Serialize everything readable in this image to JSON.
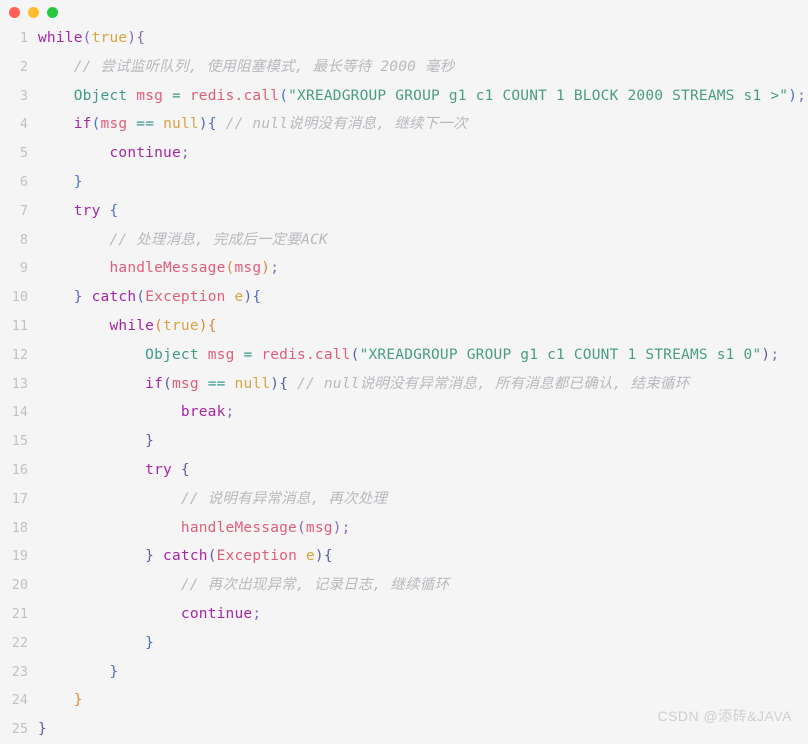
{
  "window": {
    "title_bar": {
      "close_label": "close",
      "minimize_label": "minimize",
      "maximize_label": "maximize"
    }
  },
  "watermark": "CSDN @添砖&JAVA",
  "editor": {
    "language": "java",
    "first_line_number": 1,
    "last_line_number": 25,
    "line_numbers": [
      "1",
      "2",
      "3",
      "4",
      "5",
      "6",
      "7",
      "8",
      "9",
      "10",
      "11",
      "12",
      "13",
      "14",
      "15",
      "16",
      "17",
      "18",
      "19",
      "20",
      "21",
      "22",
      "23",
      "24",
      "25"
    ],
    "lines": [
      {
        "n": "1",
        "text": "while(true){"
      },
      {
        "n": "2",
        "text": "    // 尝试监听队列, 使用阻塞模式, 最长等待 2000 毫秒"
      },
      {
        "n": "3",
        "text": "    Object msg = redis.call(\"XREADGROUP GROUP g1 c1 COUNT 1 BLOCK 2000 STREAMS s1 >\");"
      },
      {
        "n": "4",
        "text": "    if(msg == null){ // null说明没有消息, 继续下一次"
      },
      {
        "n": "5",
        "text": "        continue;"
      },
      {
        "n": "6",
        "text": "    }"
      },
      {
        "n": "7",
        "text": "    try {"
      },
      {
        "n": "8",
        "text": "        // 处理消息, 完成后一定要ACK"
      },
      {
        "n": "9",
        "text": "        handleMessage(msg);"
      },
      {
        "n": "10",
        "text": "    } catch(Exception e){"
      },
      {
        "n": "11",
        "text": "        while(true){"
      },
      {
        "n": "12",
        "text": "            Object msg = redis.call(\"XREADGROUP GROUP g1 c1 COUNT 1 STREAMS s1 0\");"
      },
      {
        "n": "13",
        "text": "            if(msg == null){ // null说明没有异常消息, 所有消息都已确认, 结束循环"
      },
      {
        "n": "14",
        "text": "                break;"
      },
      {
        "n": "15",
        "text": "            }"
      },
      {
        "n": "16",
        "text": "            try {"
      },
      {
        "n": "17",
        "text": "                // 说明有异常消息, 再次处理"
      },
      {
        "n": "18",
        "text": "                handleMessage(msg);"
      },
      {
        "n": "19",
        "text": "            } catch(Exception e){"
      },
      {
        "n": "20",
        "text": "                // 再次出现异常, 记录日志, 继续循环"
      },
      {
        "n": "21",
        "text": "                continue;"
      },
      {
        "n": "22",
        "text": "            }"
      },
      {
        "n": "23",
        "text": "        }"
      },
      {
        "n": "24",
        "text": "    }"
      },
      {
        "n": "25",
        "text": "}"
      }
    ],
    "tokens": [
      [
        {
          "t": "while",
          "c": "t-kw"
        },
        {
          "t": "(",
          "c": "t-p1"
        },
        {
          "t": "true",
          "c": "t-bool"
        },
        {
          "t": ")",
          "c": "t-p1"
        },
        {
          "t": "{",
          "c": "t-p1"
        }
      ],
      [
        {
          "t": "    // 尝试监听队列, 使用阻塞模式, 最长等待 2000 毫秒",
          "c": "t-com"
        }
      ],
      [
        {
          "t": "    ",
          "c": "t-plain"
        },
        {
          "t": "Object",
          "c": "t-type"
        },
        {
          "t": " ",
          "c": "t-plain"
        },
        {
          "t": "msg",
          "c": "t-var"
        },
        {
          "t": " ",
          "c": "t-plain"
        },
        {
          "t": "=",
          "c": "t-op"
        },
        {
          "t": " ",
          "c": "t-plain"
        },
        {
          "t": "redis.call",
          "c": "t-var"
        },
        {
          "t": "(",
          "c": "t-p2"
        },
        {
          "t": "\"XREADGROUP GROUP g1 c1 COUNT 1 BLOCK 2000 STREAMS s1 >\"",
          "c": "t-str"
        },
        {
          "t": ")",
          "c": "t-p2"
        },
        {
          "t": ";",
          "c": "t-p1"
        }
      ],
      [
        {
          "t": "    ",
          "c": "t-plain"
        },
        {
          "t": "if",
          "c": "t-kw"
        },
        {
          "t": "(",
          "c": "t-p2"
        },
        {
          "t": "msg",
          "c": "t-var"
        },
        {
          "t": " ",
          "c": "t-plain"
        },
        {
          "t": "==",
          "c": "t-op"
        },
        {
          "t": " ",
          "c": "t-plain"
        },
        {
          "t": "null",
          "c": "t-bool"
        },
        {
          "t": ")",
          "c": "t-p2"
        },
        {
          "t": "{",
          "c": "t-p2"
        },
        {
          "t": " ",
          "c": "t-plain"
        },
        {
          "t": "// null说明没有消息, 继续下一次",
          "c": "t-com"
        }
      ],
      [
        {
          "t": "        ",
          "c": "t-plain"
        },
        {
          "t": "continue",
          "c": "t-kw"
        },
        {
          "t": ";",
          "c": "t-p1"
        }
      ],
      [
        {
          "t": "    ",
          "c": "t-plain"
        },
        {
          "t": "}",
          "c": "t-p2"
        }
      ],
      [
        {
          "t": "    ",
          "c": "t-plain"
        },
        {
          "t": "try",
          "c": "t-kw"
        },
        {
          "t": " ",
          "c": "t-plain"
        },
        {
          "t": "{",
          "c": "t-p2"
        }
      ],
      [
        {
          "t": "        // 处理消息, 完成后一定要ACK",
          "c": "t-com"
        }
      ],
      [
        {
          "t": "        ",
          "c": "t-plain"
        },
        {
          "t": "handleMessage",
          "c": "t-var"
        },
        {
          "t": "(",
          "c": "t-p3"
        },
        {
          "t": "msg",
          "c": "t-var"
        },
        {
          "t": ")",
          "c": "t-p3"
        },
        {
          "t": ";",
          "c": "t-p1"
        }
      ],
      [
        {
          "t": "    ",
          "c": "t-plain"
        },
        {
          "t": "}",
          "c": "t-p2"
        },
        {
          "t": " ",
          "c": "t-plain"
        },
        {
          "t": "catch",
          "c": "t-kw"
        },
        {
          "t": "(",
          "c": "t-p2"
        },
        {
          "t": "Exception",
          "c": "t-var"
        },
        {
          "t": " ",
          "c": "t-plain"
        },
        {
          "t": "e",
          "c": "t-bool"
        },
        {
          "t": ")",
          "c": "t-p2"
        },
        {
          "t": "{",
          "c": "t-p2"
        }
      ],
      [
        {
          "t": "        ",
          "c": "t-plain"
        },
        {
          "t": "while",
          "c": "t-kw"
        },
        {
          "t": "(",
          "c": "t-p3"
        },
        {
          "t": "true",
          "c": "t-bool"
        },
        {
          "t": ")",
          "c": "t-p3"
        },
        {
          "t": "{",
          "c": "t-p3"
        }
      ],
      [
        {
          "t": "            ",
          "c": "t-plain"
        },
        {
          "t": "Object",
          "c": "t-type"
        },
        {
          "t": " ",
          "c": "t-plain"
        },
        {
          "t": "msg",
          "c": "t-var"
        },
        {
          "t": " ",
          "c": "t-plain"
        },
        {
          "t": "=",
          "c": "t-op"
        },
        {
          "t": " ",
          "c": "t-plain"
        },
        {
          "t": "redis.call",
          "c": "t-var"
        },
        {
          "t": "(",
          "c": "t-p4"
        },
        {
          "t": "\"XREADGROUP GROUP g1 c1 COUNT 1 STREAMS s1 0\"",
          "c": "t-str"
        },
        {
          "t": ")",
          "c": "t-p4"
        },
        {
          "t": ";",
          "c": "t-p1"
        }
      ],
      [
        {
          "t": "            ",
          "c": "t-plain"
        },
        {
          "t": "if",
          "c": "t-kw"
        },
        {
          "t": "(",
          "c": "t-p4"
        },
        {
          "t": "msg",
          "c": "t-var"
        },
        {
          "t": " ",
          "c": "t-plain"
        },
        {
          "t": "==",
          "c": "t-op"
        },
        {
          "t": " ",
          "c": "t-plain"
        },
        {
          "t": "null",
          "c": "t-bool"
        },
        {
          "t": ")",
          "c": "t-p4"
        },
        {
          "t": "{",
          "c": "t-p4"
        },
        {
          "t": " ",
          "c": "t-plain"
        },
        {
          "t": "// null说明没有异常消息, 所有消息都已确认, 结束循环",
          "c": "t-com"
        }
      ],
      [
        {
          "t": "                ",
          "c": "t-plain"
        },
        {
          "t": "break",
          "c": "t-kw"
        },
        {
          "t": ";",
          "c": "t-p1"
        }
      ],
      [
        {
          "t": "            ",
          "c": "t-plain"
        },
        {
          "t": "}",
          "c": "t-p4"
        }
      ],
      [
        {
          "t": "            ",
          "c": "t-plain"
        },
        {
          "t": "try",
          "c": "t-kw"
        },
        {
          "t": " ",
          "c": "t-plain"
        },
        {
          "t": "{",
          "c": "t-p4"
        }
      ],
      [
        {
          "t": "                // 说明有异常消息, 再次处理",
          "c": "t-com"
        }
      ],
      [
        {
          "t": "                ",
          "c": "t-plain"
        },
        {
          "t": "handleMessage",
          "c": "t-var"
        },
        {
          "t": "(",
          "c": "t-p1"
        },
        {
          "t": "msg",
          "c": "t-var"
        },
        {
          "t": ")",
          "c": "t-p1"
        },
        {
          "t": ";",
          "c": "t-p1"
        }
      ],
      [
        {
          "t": "            ",
          "c": "t-plain"
        },
        {
          "t": "}",
          "c": "t-p4"
        },
        {
          "t": " ",
          "c": "t-plain"
        },
        {
          "t": "catch",
          "c": "t-kw"
        },
        {
          "t": "(",
          "c": "t-p4"
        },
        {
          "t": "Exception",
          "c": "t-var"
        },
        {
          "t": " ",
          "c": "t-plain"
        },
        {
          "t": "e",
          "c": "t-bool"
        },
        {
          "t": ")",
          "c": "t-p4"
        },
        {
          "t": "{",
          "c": "t-p4"
        }
      ],
      [
        {
          "t": "                // 再次出现异常, 记录日志, 继续循环",
          "c": "t-com"
        }
      ],
      [
        {
          "t": "                ",
          "c": "t-plain"
        },
        {
          "t": "continue",
          "c": "t-kw"
        },
        {
          "t": ";",
          "c": "t-p1"
        }
      ],
      [
        {
          "t": "            ",
          "c": "t-plain"
        },
        {
          "t": "}",
          "c": "t-p2"
        }
      ],
      [
        {
          "t": "        ",
          "c": "t-plain"
        },
        {
          "t": "}",
          "c": "t-p2"
        }
      ],
      [
        {
          "t": "    ",
          "c": "t-plain"
        },
        {
          "t": "}",
          "c": "t-p3"
        }
      ],
      [
        {
          "t": "}",
          "c": "t-p4"
        }
      ]
    ]
  },
  "colors": {
    "background": "#f5f5f5",
    "traffic_close": "#ff5f56",
    "traffic_minimize": "#ffbd2e",
    "traffic_maximize": "#27c93f",
    "line_number": "#c2c2c6",
    "keyword": "#a626a4",
    "literal": "#d9a441",
    "type": "#3f9a8a",
    "identifier": "#e05e7b",
    "string": "#4a9e7f",
    "comment": "#b9b9bf",
    "watermark": "#cfcfd4"
  }
}
